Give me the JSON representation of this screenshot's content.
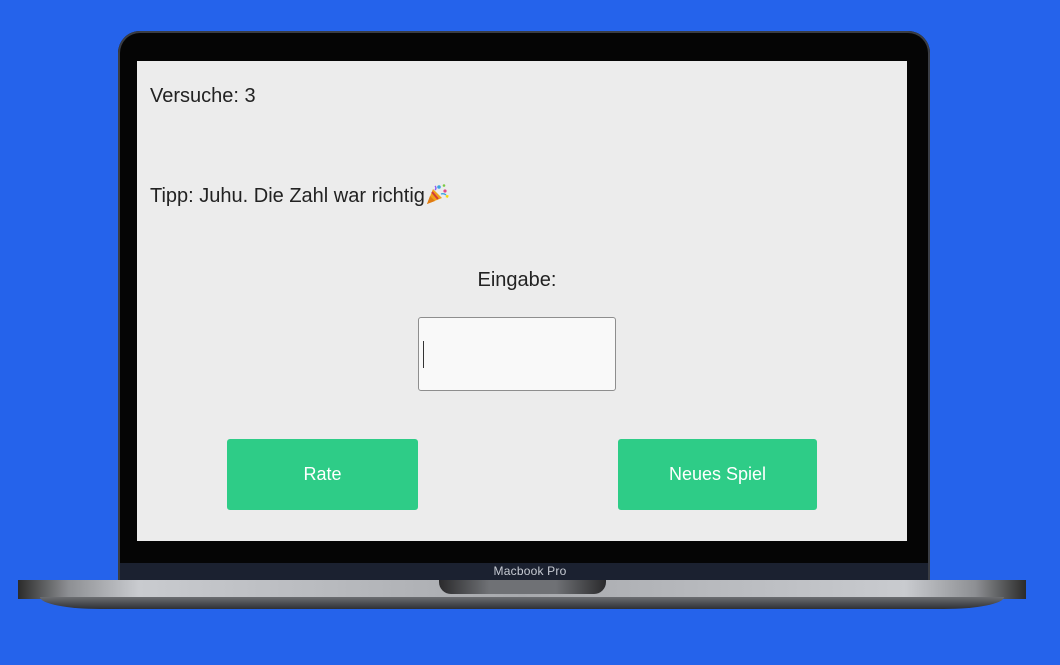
{
  "device": {
    "brand_label": "Macbook Pro"
  },
  "game": {
    "attempts_text": "Versuche: 3",
    "hint_text": "Tipp: Juhu. Die Zahl war richtig",
    "hint_icon": "party-popper-icon",
    "input_label": "Eingabe:",
    "input_value": "",
    "input_placeholder": ""
  },
  "buttons": {
    "guess_label": "Rate",
    "new_game_label": "Neues Spiel"
  },
  "colors": {
    "background": "#2563eb",
    "screen": "#ececec",
    "button": "#2ecc87",
    "button_text": "#ffffff"
  }
}
